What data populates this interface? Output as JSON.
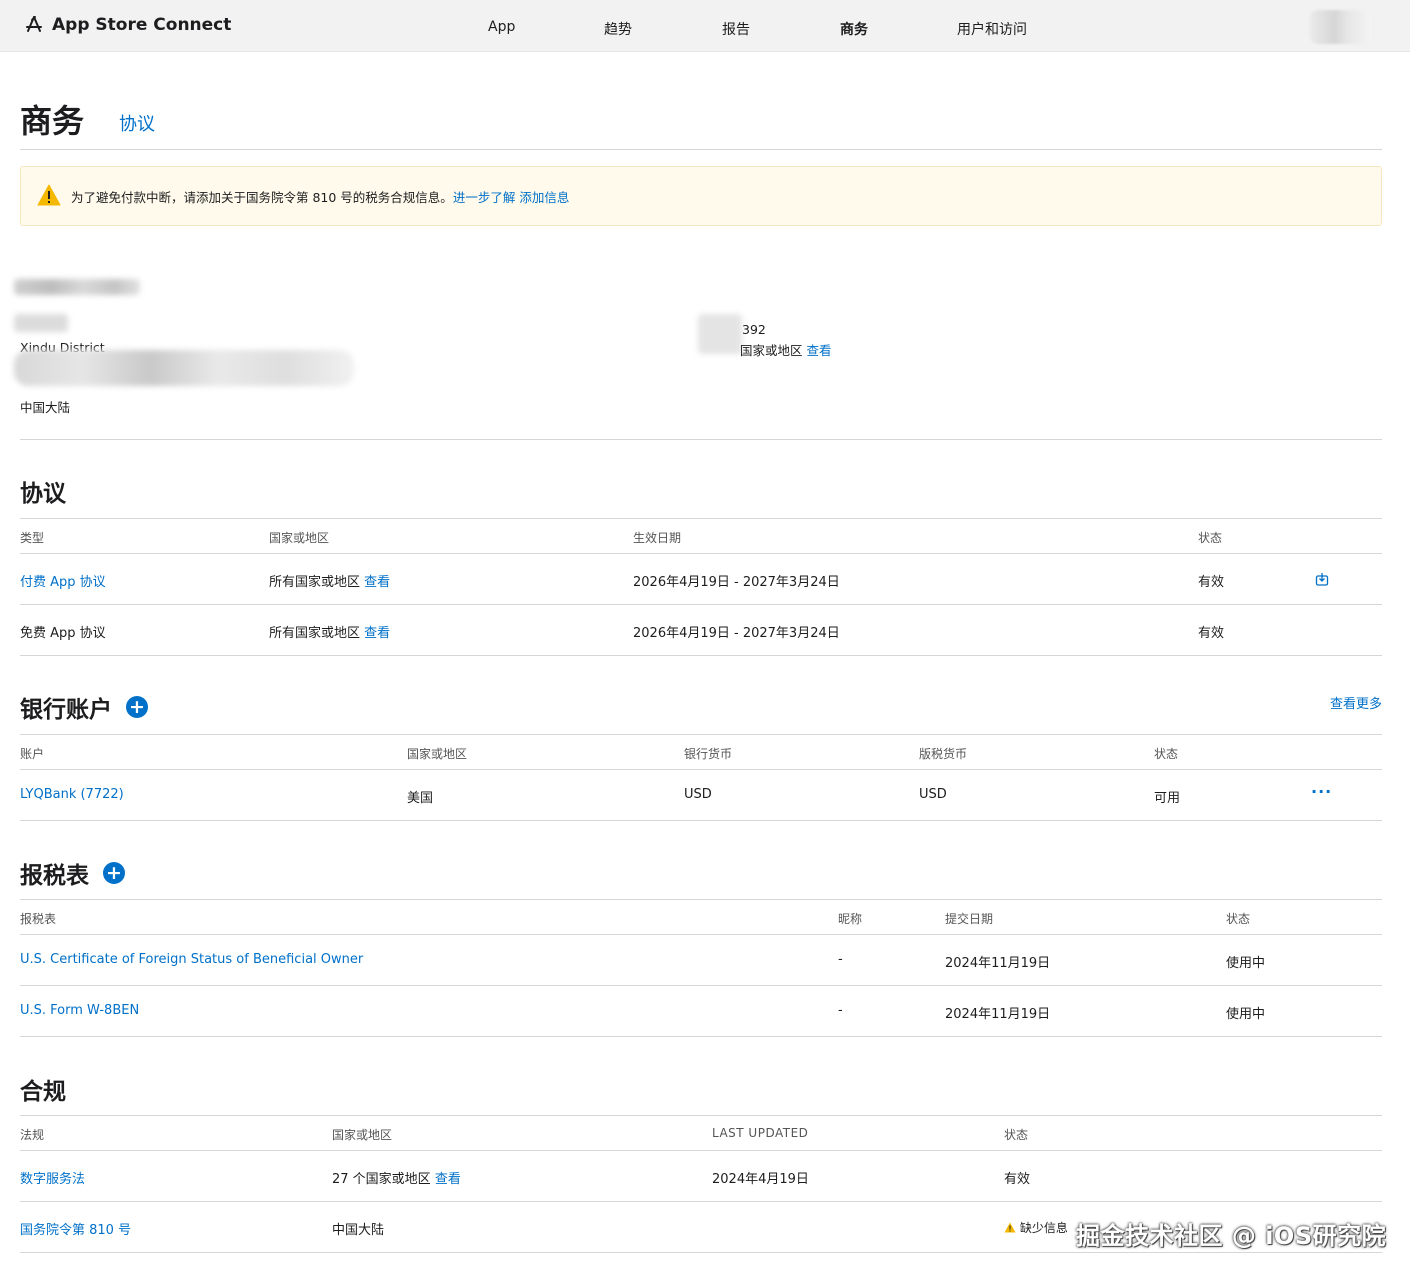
{
  "header": {
    "app_title": "App Store Connect",
    "nav": [
      {
        "label": "App"
      },
      {
        "label": "趋势"
      },
      {
        "label": "报告"
      },
      {
        "label": "商务",
        "active": true
      },
      {
        "label": "用户和访问"
      }
    ]
  },
  "page": {
    "title": "商务",
    "subnav_link": "协议"
  },
  "notice": {
    "message": "为了避免付款中断，请添加关于国务院令第 810 号的税务合规信息。",
    "learn_more": "进一步了解",
    "add_info": "添加信息"
  },
  "entity": {
    "address_line": "Xindu District",
    "country": "中国大陆",
    "id_suffix": "392",
    "regions_text": "国家或地区",
    "regions_link": "查看"
  },
  "agreements": {
    "title": "协议",
    "columns": [
      "类型",
      "国家或地区",
      "生效日期",
      "状态"
    ],
    "rows": [
      {
        "type": "付费 App 协议",
        "region": "所有国家或地区",
        "region_link": "查看",
        "dates": "2026年4月19日 - 2027年3月24日",
        "status": "有效"
      },
      {
        "type": "免费 App 协议",
        "region": "所有国家或地区",
        "region_link": "查看",
        "dates": "2026年4月19日 - 2027年3月24日",
        "status": "有效"
      }
    ]
  },
  "bank": {
    "title": "银行账户",
    "see_more": "查看更多",
    "columns": [
      "账户",
      "国家或地区",
      "银行货币",
      "版税货币",
      "状态"
    ],
    "rows": [
      {
        "account": "LYQBank (7722)",
        "country": "美国",
        "bank_currency": "USD",
        "royalty_currency": "USD",
        "status": "可用",
        "menu": "···"
      }
    ]
  },
  "tax": {
    "title": "报税表",
    "columns": [
      "报税表",
      "昵称",
      "提交日期",
      "状态"
    ],
    "rows": [
      {
        "form": "U.S. Certificate of Foreign Status of Beneficial Owner",
        "nickname": "-",
        "date": "2024年11月19日",
        "status": "使用中"
      },
      {
        "form": "U.S. Form W-8BEN",
        "nickname": "-",
        "date": "2024年11月19日",
        "status": "使用中"
      }
    ]
  },
  "compliance": {
    "title": "合规",
    "columns": [
      "法规",
      "国家或地区",
      "LAST UPDATED",
      "状态"
    ],
    "rows": [
      {
        "law": "数字服务法",
        "region": "27 个国家或地区",
        "region_link": "查看",
        "updated": "2024年4月19日",
        "status": "有效"
      },
      {
        "law": "国务院令第 810 号",
        "region": "中国大陆",
        "updated": "",
        "status": "缺少信息"
      }
    ]
  },
  "watermark": "掘金技术社区 @ iOS研究院",
  "colors": {
    "accent": "#0070c9",
    "warning": "#f5b800",
    "notice_bg": "#fffaeb"
  }
}
